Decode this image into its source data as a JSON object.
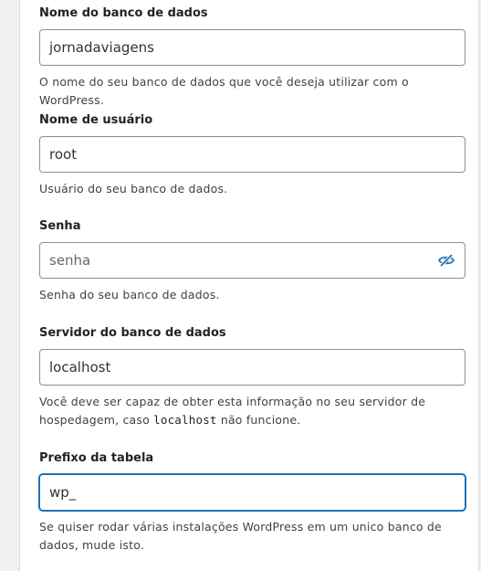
{
  "fields": [
    {
      "label": "Nome do banco de dados",
      "value": "jornadaviagens",
      "description": "O nome do seu banco de dados que você deseja utilizar com o WordPress."
    },
    {
      "label": "Nome de usuário",
      "value": "root",
      "description": "Usuário do seu banco de dados."
    },
    {
      "label": "Senha",
      "placeholder": "senha",
      "description": "Senha do seu banco de dados.",
      "icon": "eye-slash-icon"
    },
    {
      "label": "Servidor do banco de dados",
      "value": "localhost",
      "description_before": "Você deve ser capaz de obter esta informação no seu servidor de hospedagem, caso ",
      "description_code": "localhost",
      "description_after": " não funcione."
    },
    {
      "label": "Prefixo da tabela",
      "value": "wp_",
      "description": "Se quiser rodar várias instalações WordPress em um unico banco de dados, mude isto."
    }
  ],
  "colors": {
    "accent": "#2271b1",
    "border": "#8c8f94",
    "background": "#f0f0f1"
  }
}
